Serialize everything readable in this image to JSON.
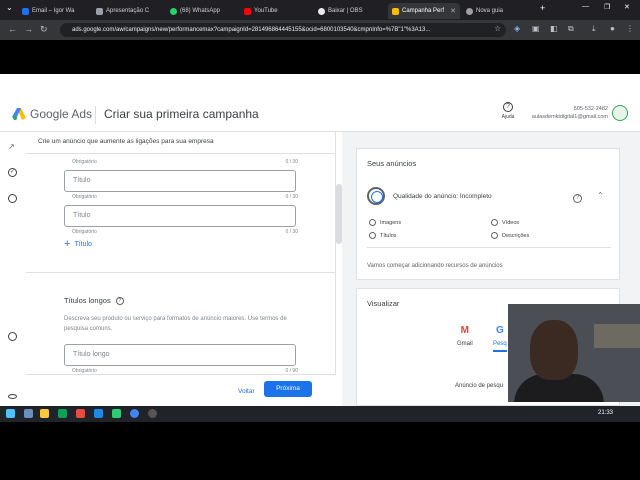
{
  "browser": {
    "tabs": [
      {
        "label": "Email – Igor Wa",
        "active": false
      },
      {
        "label": "Apresentação C",
        "active": false
      },
      {
        "label": "(68) WhatsApp",
        "active": false
      },
      {
        "label": "YouTube",
        "active": false
      },
      {
        "label": "Baixar | OBS",
        "active": false
      },
      {
        "label": "Campanha Perf",
        "active": true
      },
      {
        "label": "Nova guia",
        "active": false
      }
    ],
    "url": "ads.google.com/aw/campaigns/new/performancemax?campaignId=281496864445155&ocid=6800103540&cmpnInfo=%7B\"1\"%3A13..."
  },
  "header": {
    "logo_text": "Google Ads",
    "page_title": "Criar sua primeira campanha",
    "help_label": "Ajuda",
    "phone": "505-532-2482",
    "email": "aulasdemktdigital1@gmail.com"
  },
  "main": {
    "subtitle": "Crie um anúncio que aumente as ligações para sua empresa",
    "top_hint": "Obrigatório",
    "top_counter": "0 / 30",
    "title_fields": [
      {
        "placeholder": "Título",
        "hint": "Obrigatório",
        "counter": "0 / 30"
      },
      {
        "placeholder": "Título",
        "hint": "Obrigatório",
        "counter": "0 / 30"
      }
    ],
    "add_title_label": "Título",
    "long_titles": {
      "heading": "Títulos longos",
      "description": "Descreva seu produto ou serviço para formatos de anúncio maiores. Use termos de pesquisa comuns.",
      "field_placeholder": "Título longo",
      "hint": "Obrigatório",
      "counter": "0 / 90"
    },
    "back_button": "Voltar",
    "next_button": "Próxima"
  },
  "preview": {
    "ads_card_title": "Seus anúncios",
    "quality": "Qualidade do anúncio: Incompleto",
    "checklist": [
      "Imagens",
      "Vídeos",
      "Títulos",
      "Descrições"
    ],
    "start_message": "Vamos começar adicionando recursos de anúncios",
    "visualize_title": "Visualizar",
    "channels": [
      "Gmail",
      "Pesq"
    ],
    "ad_label": "Anúncio de pesqu"
  },
  "taskbar": {
    "time": "21:33"
  },
  "colors": {
    "accent": "#1a73e8",
    "browser_dark": "#35363a"
  }
}
